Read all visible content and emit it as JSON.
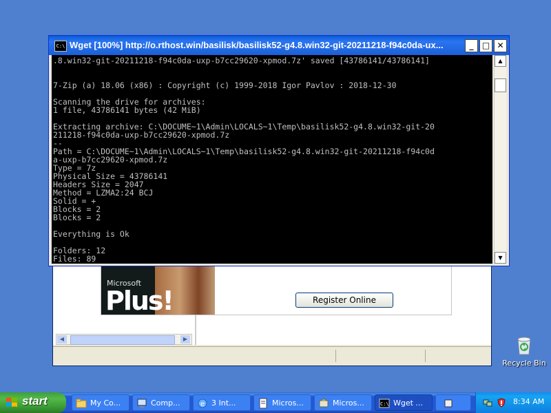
{
  "console": {
    "title": "Wget [100%] http://o.rthost.win/basilisk/basilisk52-g4.8.win32-git-20211218-f94c0da-ux...",
    "lines": [
      ".8.win32-git-20211218-f94c0da-uxp-b7cc29620-xpmod.7z' saved [43786141/43786141]",
      "",
      "",
      "7-Zip (a) 18.06 (x86) : Copyright (c) 1999-2018 Igor Pavlov : 2018-12-30",
      "",
      "Scanning the drive for archives:",
      "1 file, 43786141 bytes (42 MiB)",
      "",
      "Extracting archive: C:\\DOCUME~1\\Admin\\LOCALS~1\\Temp\\basilisk52-g4.8.win32-git-20",
      "211218-f94c0da-uxp-b7cc29620-xpmod.7z",
      "--",
      "Path = C:\\DOCUME~1\\Admin\\LOCALS~1\\Temp\\basilisk52-g4.8.win32-git-20211218-f94c0d",
      "a-uxp-b7cc29620-xpmod.7z",
      "Type = 7z",
      "Physical Size = 43786141",
      "Headers Size = 2047",
      "Method = LZMA2:24 BCJ",
      "Solid = +",
      "Blocks = 2",
      "Blocks = 2",
      "",
      "Everything is Ok",
      "",
      "Folders: 12",
      "Files: 89"
    ],
    "icon_label": "C:\\"
  },
  "background_window": {
    "brand_small": "Microsoft",
    "brand_large": "Plus!",
    "register_button": "Register Online"
  },
  "desktop": {
    "recycle_bin_label": "Recycle Bin"
  },
  "taskbar": {
    "start_label": "start",
    "buttons": [
      {
        "label": "My Co...",
        "icon": "folder-icon"
      },
      {
        "label": "Comp...",
        "icon": "computer-icon"
      },
      {
        "label": "3 Int...",
        "icon": "internet-explorer-icon"
      },
      {
        "label": "Micros...",
        "icon": "document-icon"
      },
      {
        "label": "Micros...",
        "icon": "setup-icon"
      },
      {
        "label": "Wget ...",
        "icon": "console-icon"
      }
    ],
    "clock": "8:34 AM"
  },
  "colors": {
    "taskbar": "#2458d3",
    "start": "#3a9c36",
    "titlebar": "#0a5bd7",
    "console_bg": "#000000",
    "console_fg": "#c0c0c0"
  }
}
